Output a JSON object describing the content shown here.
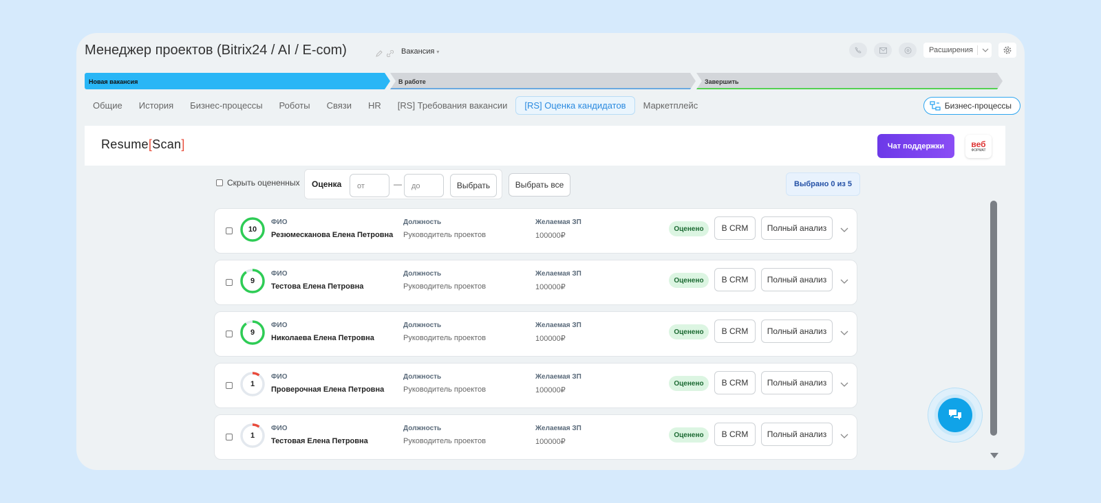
{
  "header": {
    "title": "Менеджер проектов (Bitrix24 / AI / E-com)",
    "vacancy_dropdown": "Вакансия",
    "extensions_label": "Расширения"
  },
  "stages": [
    {
      "label": "Новая вакансия",
      "color": "#29b6f6"
    },
    {
      "label": "В работе",
      "color": "#d3d6da"
    },
    {
      "label": "Завершить",
      "color": "#d3d6da"
    }
  ],
  "tabs": [
    {
      "label": "Общие"
    },
    {
      "label": "История"
    },
    {
      "label": "Бизнес-процессы"
    },
    {
      "label": "Роботы"
    },
    {
      "label": "Связи"
    },
    {
      "label": "HR"
    },
    {
      "label": "[RS] Требования вакансии"
    },
    {
      "label": "[RS] Оценка кандидатов",
      "active": true
    },
    {
      "label": "Маркетплейс"
    }
  ],
  "bp_button": "Бизнес-процессы",
  "app": {
    "logo_left": "Resume",
    "logo_right": "Scan",
    "support_chat": "Чат поддержки",
    "partner_logo_top": "веб",
    "partner_logo_bottom": "ФОРМАТ"
  },
  "filter": {
    "hide_rated": "Скрыть оцененных",
    "score_label": "Оценка",
    "from_placeholder": "от",
    "dash": "—",
    "to_placeholder": "до",
    "apply": "Выбрать",
    "select_all": "Выбрать все",
    "selected_info": "Выбрано 0 из 5"
  },
  "columns": {
    "name": "ФИО",
    "position": "Должность",
    "salary": "Желаемая ЗП"
  },
  "candidates": [
    {
      "score": "10",
      "score_fraction": 1.0,
      "name": "Резюмесканова Елена Петровна",
      "position": "Руководитель проектов",
      "salary": "100000₽",
      "status": "Оценено",
      "crm": "В CRM",
      "analysis": "Полный анализ"
    },
    {
      "score": "9",
      "score_fraction": 0.9,
      "name": "Тестова Елена Петровна",
      "position": "Руководитель проектов",
      "salary": "100000₽",
      "status": "Оценено",
      "crm": "В CRM",
      "analysis": "Полный анализ"
    },
    {
      "score": "9",
      "score_fraction": 0.9,
      "name": "Николаева Елена Петровна",
      "position": "Руководитель проектов",
      "salary": "100000₽",
      "status": "Оценено",
      "crm": "В CRM",
      "analysis": "Полный анализ"
    },
    {
      "score": "1",
      "score_fraction": 0.1,
      "name": "Проверочная Елена Петровна",
      "position": "Руководитель проектов",
      "salary": "100000₽",
      "status": "Оценено",
      "crm": "В CRM",
      "analysis": "Полный анализ"
    },
    {
      "score": "1",
      "score_fraction": 0.1,
      "name": "Тестовая Елена Петровна",
      "position": "Руководитель проектов",
      "salary": "100000₽",
      "status": "Оценено",
      "crm": "В CRM",
      "analysis": "Полный анализ"
    }
  ],
  "colors": {
    "high_score": "#2ecc55",
    "low_score": "#e94b3c",
    "ring_track": "#e3e8ee",
    "accent": "#29b6f6"
  }
}
